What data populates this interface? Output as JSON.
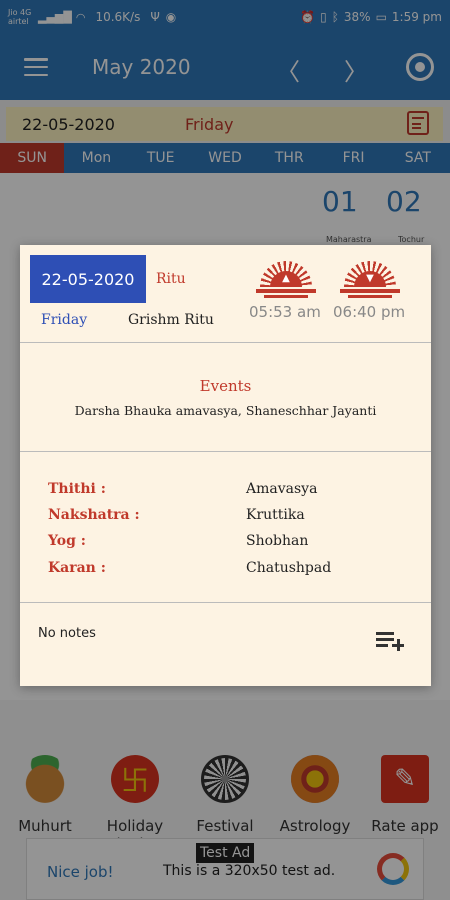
{
  "status_bar": {
    "carrier_line1": "Jio 4G",
    "carrier_line2": "airtel",
    "speed": "10.6K/s",
    "battery": "38%",
    "time": "1:59 pm"
  },
  "app_bar": {
    "title": "May 2020",
    "menu_icon": "hamburger-menu-icon",
    "prev_icon": "chevron-left-icon",
    "next_icon": "chevron-right-icon",
    "locate_icon": "target-icon"
  },
  "date_bar": {
    "date": "22-05-2020",
    "day": "Friday",
    "calendar_icon": "calendar-icon"
  },
  "weekdays": [
    "SUN",
    "Mon",
    "TUE",
    "WED",
    "THR",
    "FRI",
    "SAT"
  ],
  "background_days": {
    "fri": "01",
    "sat": "02",
    "fri_note": "Maharastra",
    "sat_note": "Tochur"
  },
  "dialog": {
    "date": "22-05-2020",
    "ritu_label": "Ritu",
    "day_name": "Friday",
    "ritu_value": "Grishm Ritu",
    "sunrise_time": "05:53 am",
    "sunset_time": "06:40 pm",
    "events_title": "Events",
    "events_text": "Darsha Bhauka amavasya, Shaneschhar Jayanti",
    "panchang": [
      {
        "label": "Thithi :",
        "value": "Amavasya"
      },
      {
        "label": "Nakshatra :",
        "value": "Kruttika"
      },
      {
        "label": "Yog :",
        "value": "Shobhan"
      },
      {
        "label": "Karan :",
        "value": "Chatushpad"
      }
    ],
    "notes_text": "No notes",
    "add_note_icon": "playlist-add-icon"
  },
  "quick_links": [
    {
      "label": "Muhurt",
      "icon": "kalash-icon"
    },
    {
      "label": "Holiday Planing",
      "icon": "swastik-icon"
    },
    {
      "label": "Festival",
      "icon": "rangoli-icon"
    },
    {
      "label": "Astrology",
      "icon": "zodiac-wheel-icon"
    },
    {
      "label": "Rate app",
      "icon": "rate-pen-icon"
    }
  ],
  "ad": {
    "tag": "Test Ad",
    "nice": "Nice job!",
    "text": "This is a 320x50 test ad."
  }
}
